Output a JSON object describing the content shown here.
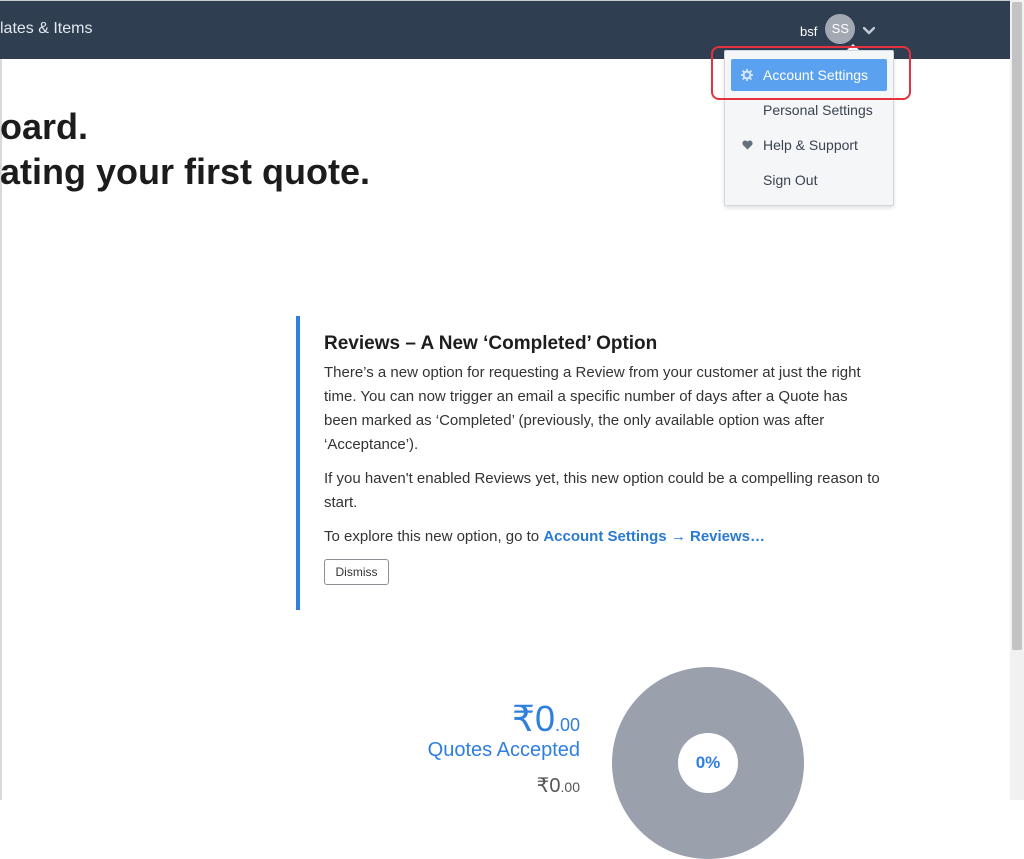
{
  "topbar": {
    "nav_partial": "lates & Items",
    "user_name": "bsf",
    "avatar_initials": "SS"
  },
  "hero": {
    "line1": "oard.",
    "line2": "ating your first quote."
  },
  "user_menu": {
    "items": [
      {
        "label": "Account Settings",
        "icon": "gear-icon",
        "active": true
      },
      {
        "label": "Personal Settings",
        "icon": ""
      },
      {
        "label": "Help & Support",
        "icon": "heart-icon"
      },
      {
        "label": "Sign Out",
        "icon": ""
      }
    ]
  },
  "notice": {
    "title": "Reviews – A New ‘Completed’ Option",
    "para1": "There’s a new option for requesting a Review from your customer at just the right time. You can now trigger an email a specific number of days after a Quote has been marked as ‘Completed’ (previously, the only available option was after ‘Acceptance’).",
    "para2": "If you haven't enabled Reviews yet, this new option could be a compelling reason to start.",
    "para3_prefix": "To explore this new option, go to ",
    "para3_link": "Account Settings → Reviews…",
    "dismiss_label": "Dismiss"
  },
  "stats": {
    "currency": "₹",
    "amount_whole": "0",
    "amount_decimal": ".00",
    "label": "Quotes Accepted",
    "sub_whole": "0",
    "sub_decimal": ".00",
    "percent": "0%"
  },
  "colors": {
    "topbar": "#2f3e51",
    "accent": "#2f7fdc",
    "menu_active": "#5aa2f0",
    "highlight": "#e5323f",
    "pie": "#9aa1ad"
  }
}
